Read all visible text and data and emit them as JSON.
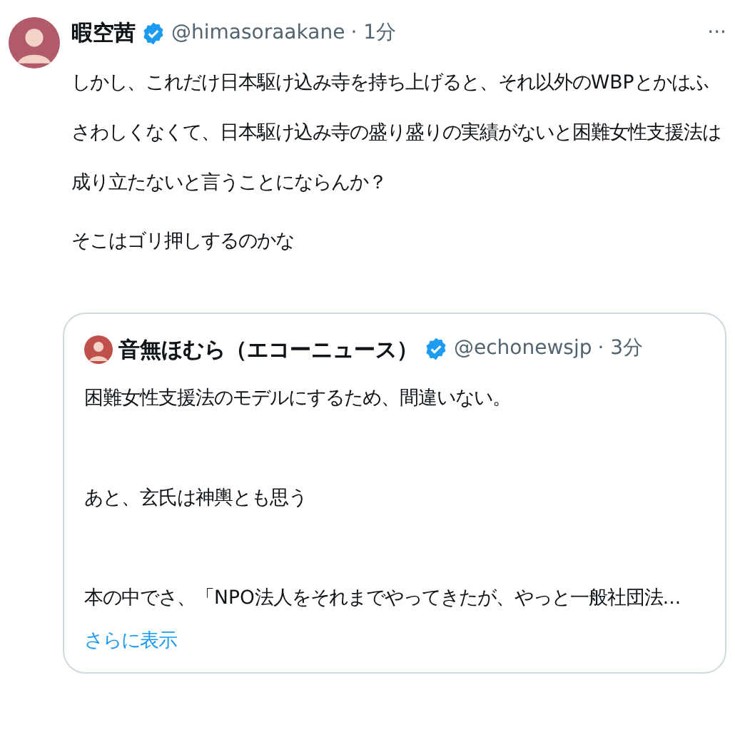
{
  "tweet": {
    "display_name": "暇空茜",
    "verified": true,
    "handle": "@himasoraakane",
    "time": "· 1分",
    "more": "···",
    "paragraphs": [
      "しかし、これだけ日本駆け込み寺を持ち上げると、それ以外のWBPとかはふさわしくなくて、日本駆け込み寺の盛り盛りの実績がないと困難女性支援法は成り立たないと言うことにならんか？",
      "そこはゴリ押しするのかな"
    ],
    "quoted": {
      "display_name": "音無ほむら（エコーニュース）",
      "verified": true,
      "handle": "@echonewsjp",
      "time": "· 3分",
      "paragraphs": [
        "困難女性支援法のモデルにするため、間違いない。",
        "あと、玄氏は神輿とも思う",
        "本の中でさ、「NPO法人をそれまでやってきたが、やっと一般社団法..."
      ],
      "show_more": "さらに表示"
    }
  }
}
